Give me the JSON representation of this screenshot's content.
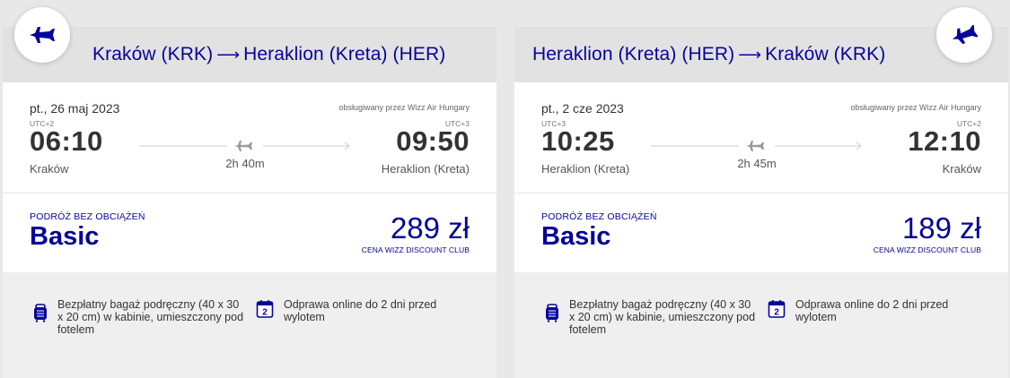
{
  "colors": {
    "brand": "#06049a",
    "text": "#333333",
    "muted": "#777777"
  },
  "flights": [
    {
      "header": {
        "from": "Kraków (KRK)",
        "arrow": "⟶",
        "to": "Heraklion (Kreta) (HER)"
      },
      "date": "pt., 26 maj 2023",
      "operator": "obsługiwany przez Wizz Air Hungary",
      "departure": {
        "tz": "UTC+2",
        "time": "06:10",
        "city": "Kraków"
      },
      "arrival": {
        "tz": "UTC+3",
        "time": "09:50",
        "city": "Heraklion (Kreta)"
      },
      "duration": "2h 40m",
      "fare": {
        "label": "PODRÓŻ BEZ OBCIĄŻEŃ",
        "name": "Basic",
        "price": "289 zł",
        "note": "CENA WIZZ DISCOUNT CLUB"
      },
      "features": [
        {
          "icon": "luggage-icon",
          "text": "Bezpłatny bagaż podręczny (40 x 30 x 20 cm) w kabinie, umieszczony pod fotelem"
        },
        {
          "icon": "calendar-icon",
          "icon_text": "2",
          "text": "Odprawa online do 2 dni przed wylotem"
        }
      ]
    },
    {
      "header": {
        "from": "Heraklion (Kreta) (HER)",
        "arrow": "⟶",
        "to": "Kraków (KRK)"
      },
      "date": "pt., 2 cze 2023",
      "operator": "obsługiwany przez Wizz Air Hungary",
      "departure": {
        "tz": "UTC+3",
        "time": "10:25",
        "city": "Heraklion (Kreta)"
      },
      "arrival": {
        "tz": "UTC+2",
        "time": "12:10",
        "city": "Kraków"
      },
      "duration": "2h 45m",
      "fare": {
        "label": "PODRÓŻ BEZ OBCIĄŻEŃ",
        "name": "Basic",
        "price": "189 zł",
        "note": "CENA WIZZ DISCOUNT CLUB"
      },
      "features": [
        {
          "icon": "luggage-icon",
          "text": "Bezpłatny bagaż podręczny (40 x 30 x 20 cm) w kabinie, umieszczony pod fotelem"
        },
        {
          "icon": "calendar-icon",
          "icon_text": "2",
          "text": "Odprawa online do 2 dni przed wylotem"
        }
      ]
    }
  ]
}
